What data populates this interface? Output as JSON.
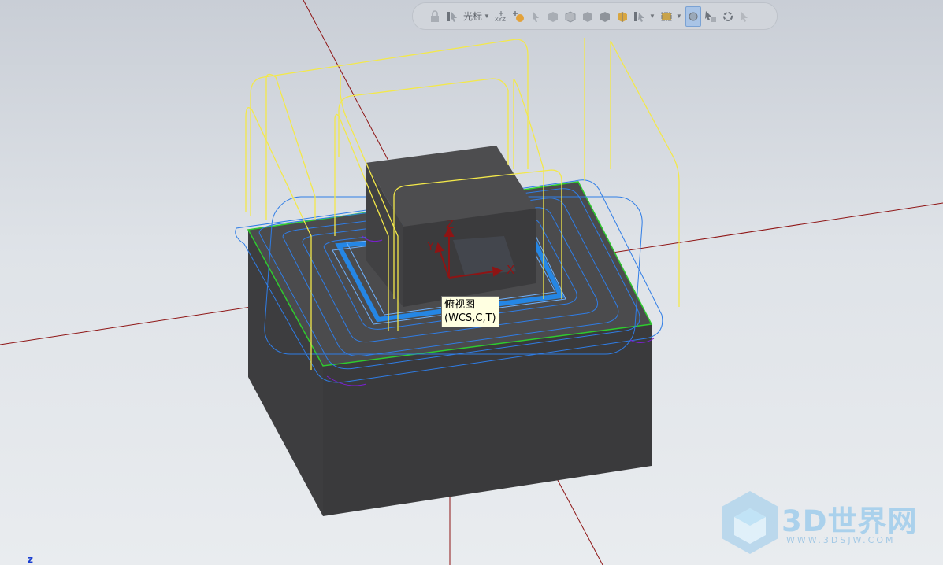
{
  "toolbar": {
    "cursor_label": "光标",
    "items": [
      "lock-icon",
      "select-cursor-icon",
      "snap-xyz-icon",
      "add-point-icon",
      "pointer-icon",
      "shaded-icon",
      "shaded-edges-icon",
      "wireframe-icon",
      "hidden-icon",
      "section-icon",
      "select-filter-icon",
      "box-select-icon",
      "orient-view-icon",
      "select-tool-icon",
      "rotate-icon",
      "fit-icon"
    ]
  },
  "tooltip": {
    "line1": "俯视图",
    "line2": "(WCS,C,T)"
  },
  "axes": {
    "x": "X",
    "y": "Y",
    "z": "Z"
  },
  "corner_axis": "z",
  "watermark": {
    "title": "3D世界网",
    "url": "WWW.3DSJW.COM"
  },
  "colors": {
    "solid": "#444446",
    "toolpath_blue": "#2f7de6",
    "rapid_yellow": "#f3e84a",
    "edge_green": "#2ecb2e",
    "axis_red": "#8e1414",
    "engage_purple": "#7a1fd0"
  }
}
